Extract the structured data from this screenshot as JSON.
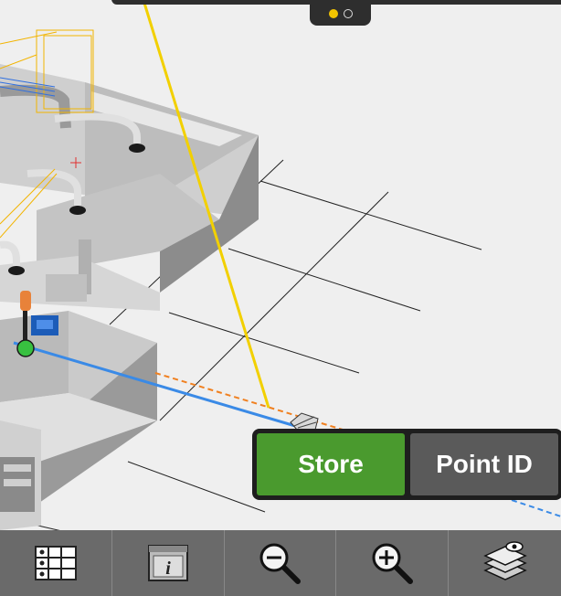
{
  "pager": {
    "active_index": 0,
    "count": 2
  },
  "actions": {
    "store_label": "Store",
    "point_id_label": "Point ID"
  },
  "toolbar": {
    "items": [
      {
        "icon": "table-grid-icon"
      },
      {
        "icon": "info-icon"
      },
      {
        "icon": "zoom-out-icon"
      },
      {
        "icon": "zoom-in-icon"
      },
      {
        "icon": "layers-visibility-icon"
      }
    ]
  },
  "colors": {
    "store": "#4a9a2e",
    "point_id": "#5a5a5a",
    "toolbar": "#6a6a6a",
    "accent": "#f2c400"
  }
}
